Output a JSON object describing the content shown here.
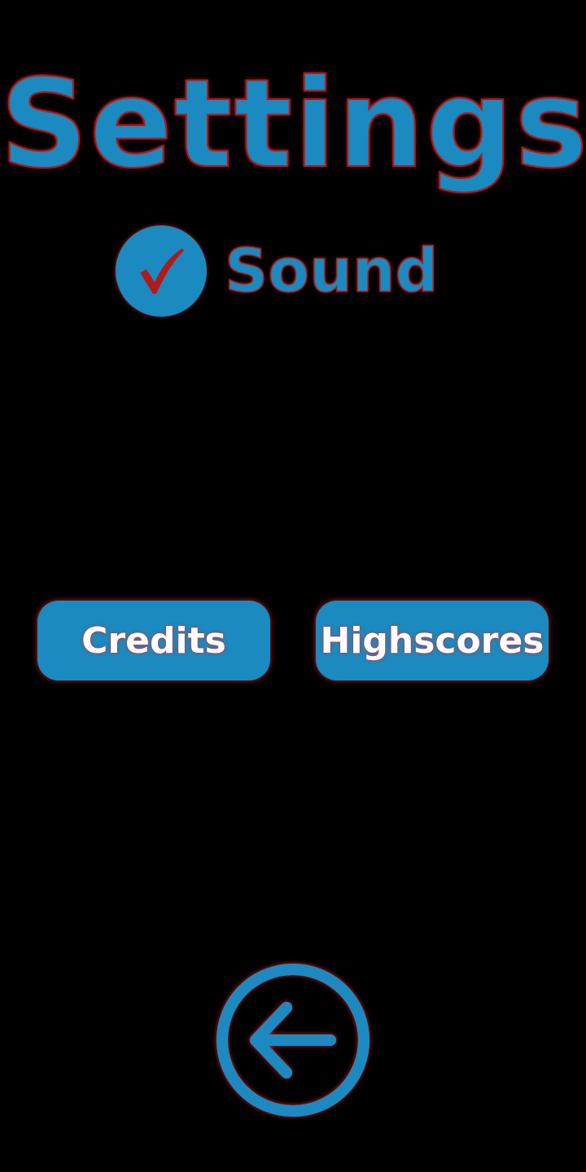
{
  "screen": {
    "title": "Settings",
    "background_color": "#000000",
    "accent_color": "#1a8ac0",
    "glow_color": "#d02828",
    "check_color": "#b01a1a"
  },
  "sound": {
    "label": "Sound",
    "checked": true,
    "icon": "checkmark-icon"
  },
  "buttons": {
    "credits_label": "Credits",
    "highscores_label": "Highscores"
  },
  "back": {
    "icon": "arrow-left-icon"
  }
}
